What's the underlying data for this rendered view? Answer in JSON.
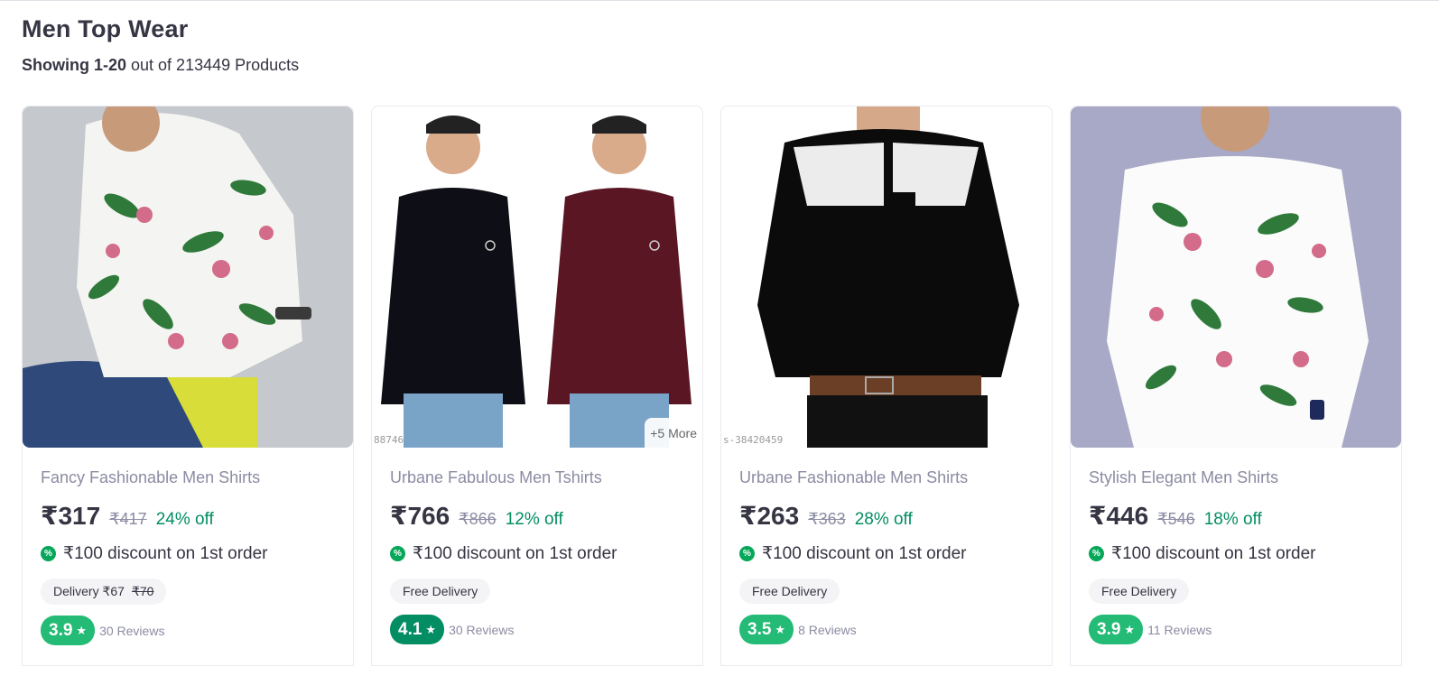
{
  "page": {
    "title": "Men Top Wear",
    "showing_bold": "Showing 1-20",
    "showing_rest": " out of 213449 Products"
  },
  "offer_text": "₹100 discount on 1st order",
  "products": [
    {
      "name": "Fancy Fashionable Men Shirts",
      "price": "₹317",
      "mrp": "₹417",
      "discount": "24% off",
      "delivery_label": "Delivery ₹67",
      "delivery_strike": "₹70",
      "rating": "3.9",
      "rating_color": "#23bb75",
      "reviews": "30 Reviews",
      "more_tag": "",
      "watermark": ""
    },
    {
      "name": "Urbane Fabulous Men Tshirts",
      "price": "₹766",
      "mrp": "₹866",
      "discount": "12% off",
      "delivery_label": "Free Delivery",
      "delivery_strike": "",
      "rating": "4.1",
      "rating_color": "#038d63",
      "reviews": "30 Reviews",
      "more_tag": "+5 More",
      "watermark": "88746"
    },
    {
      "name": "Urbane Fashionable Men Shirts",
      "price": "₹263",
      "mrp": "₹363",
      "discount": "28% off",
      "delivery_label": "Free Delivery",
      "delivery_strike": "",
      "rating": "3.5",
      "rating_color": "#23bb75",
      "reviews": "8 Reviews",
      "more_tag": "",
      "watermark": "s-38420459"
    },
    {
      "name": "Stylish Elegant Men Shirts",
      "price": "₹446",
      "mrp": "₹546",
      "discount": "18% off",
      "delivery_label": "Free Delivery",
      "delivery_strike": "",
      "rating": "3.9",
      "rating_color": "#23bb75",
      "reviews": "11 Reviews",
      "more_tag": "",
      "watermark": ""
    }
  ],
  "colors": {
    "accent_green": "#038d63",
    "rating_green": "#23bb75",
    "offer_icon_green": "#06a759",
    "text_dark": "#353543",
    "text_muted": "#8b8ba3"
  },
  "icons": {
    "offer": "discount-badge-icon",
    "star": "star-icon"
  }
}
